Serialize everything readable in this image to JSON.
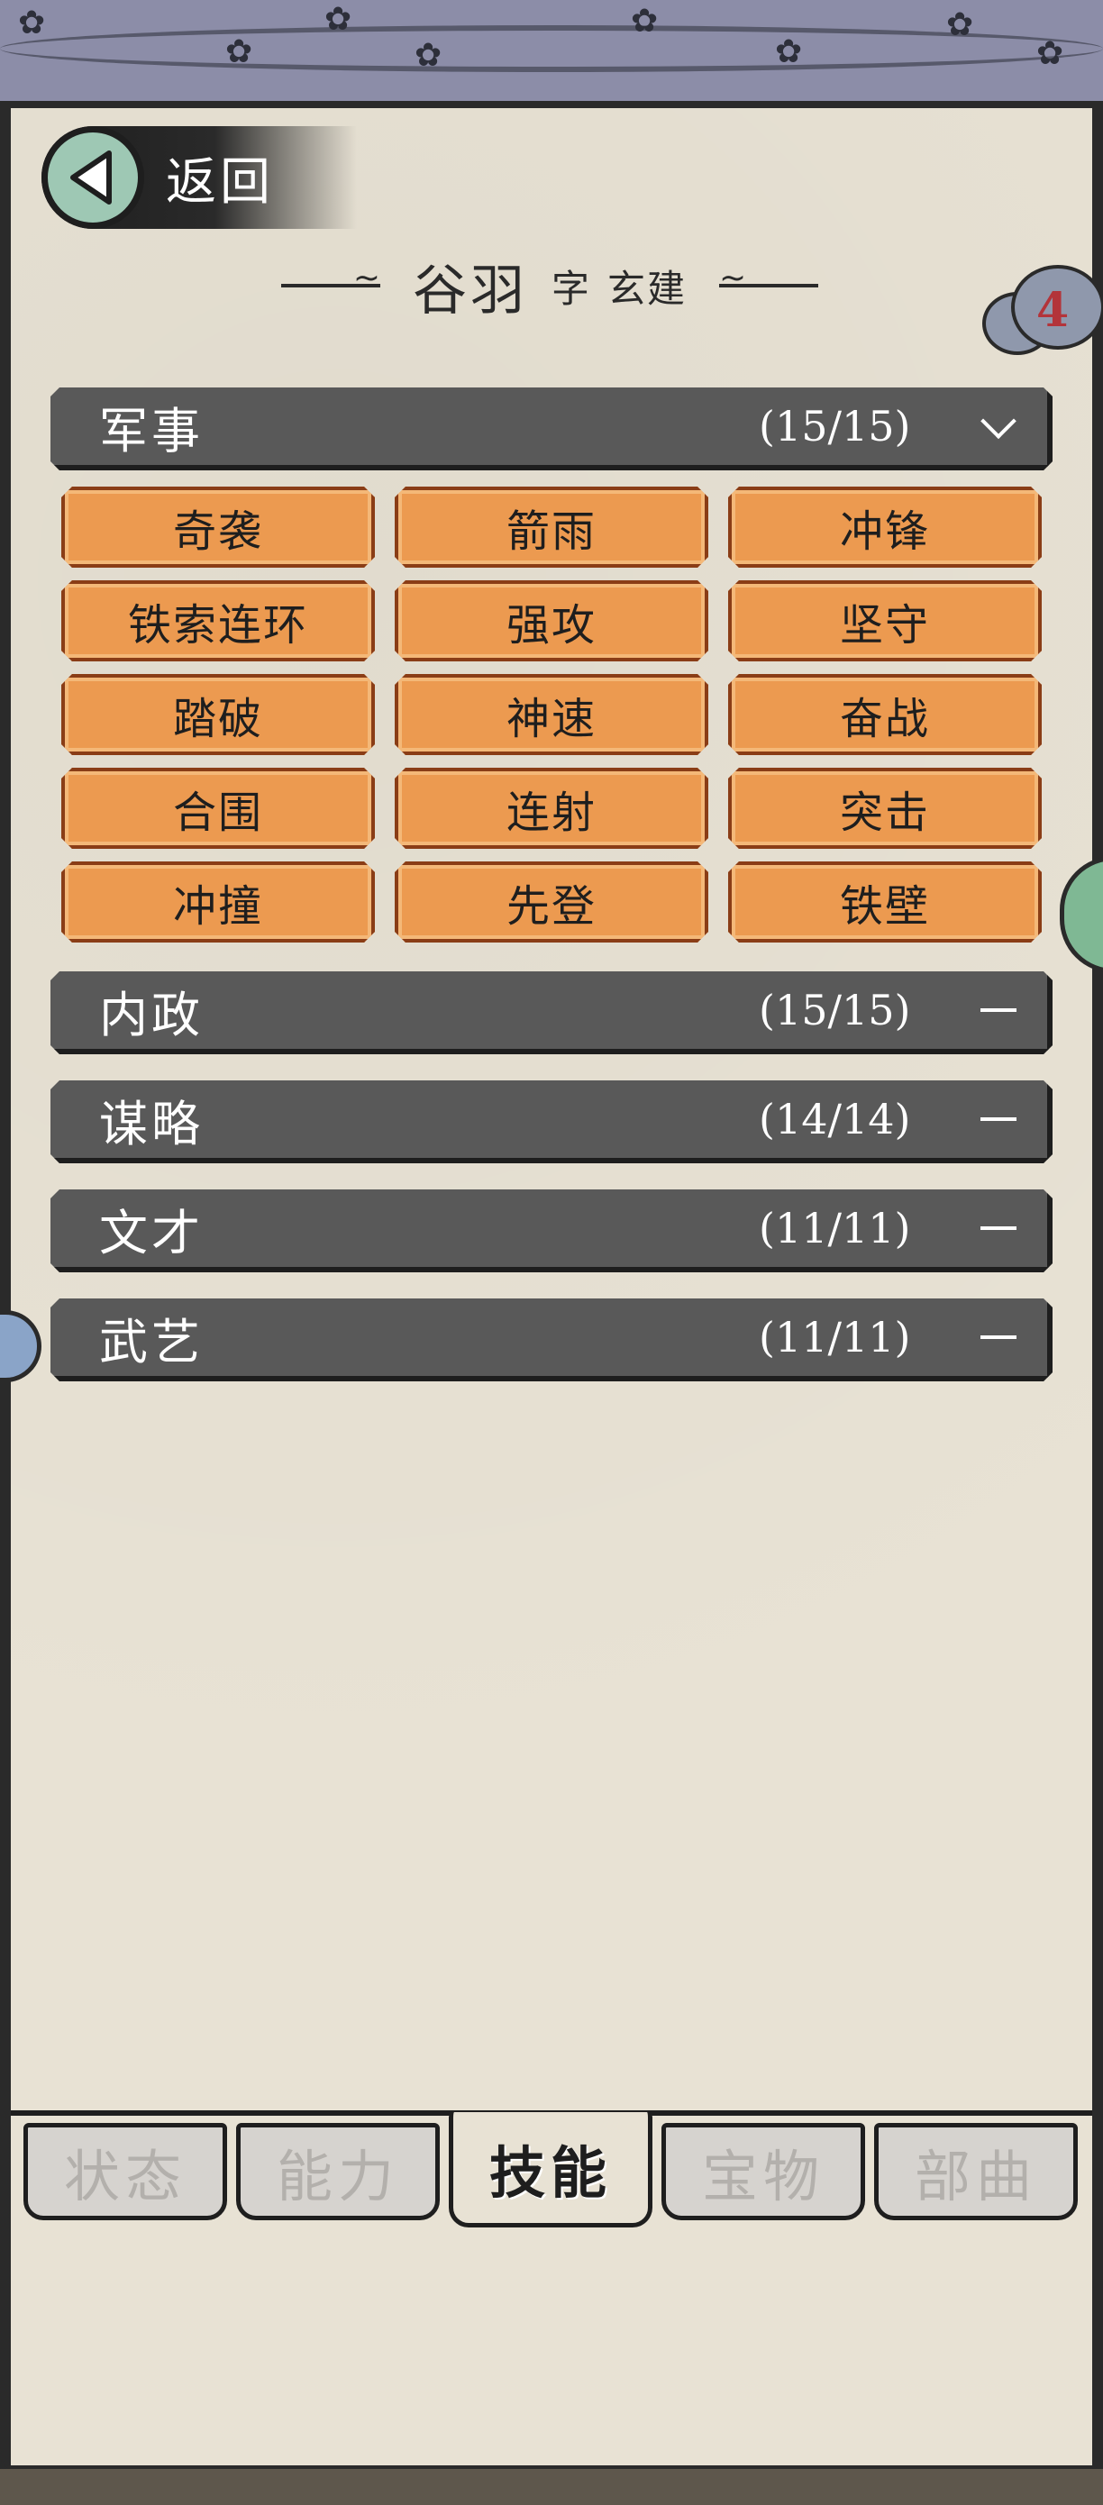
{
  "header": {
    "back_label": "返回",
    "name": "谷羽",
    "zi_label": "字",
    "style_name": "玄建",
    "badge_count": "4"
  },
  "categories": [
    {
      "name": "军事",
      "count": "(15/15)",
      "expanded": true
    },
    {
      "name": "内政",
      "count": "(15/15)",
      "expanded": false
    },
    {
      "name": "谋略",
      "count": "(14/14)",
      "expanded": false
    },
    {
      "name": "文才",
      "count": "(11/11)",
      "expanded": false
    },
    {
      "name": "武艺",
      "count": "(11/11)",
      "expanded": false
    }
  ],
  "military_skills": [
    "奇袭",
    "箭雨",
    "冲锋",
    "铁索连环",
    "强攻",
    "坚守",
    "踏破",
    "神速",
    "奋战",
    "合围",
    "连射",
    "突击",
    "冲撞",
    "先登",
    "铁壁"
  ],
  "tabs": [
    {
      "label": "状态",
      "active": false
    },
    {
      "label": "能力",
      "active": false
    },
    {
      "label": "技能",
      "active": true
    },
    {
      "label": "宝物",
      "active": false
    },
    {
      "label": "部曲",
      "active": false
    }
  ],
  "colors": {
    "skill_fill": "#ec9a50",
    "category_bg": "#595959",
    "paper": "#e8e2d4",
    "back_circle": "#9ec8b4",
    "badge_number": "#b3343a"
  }
}
